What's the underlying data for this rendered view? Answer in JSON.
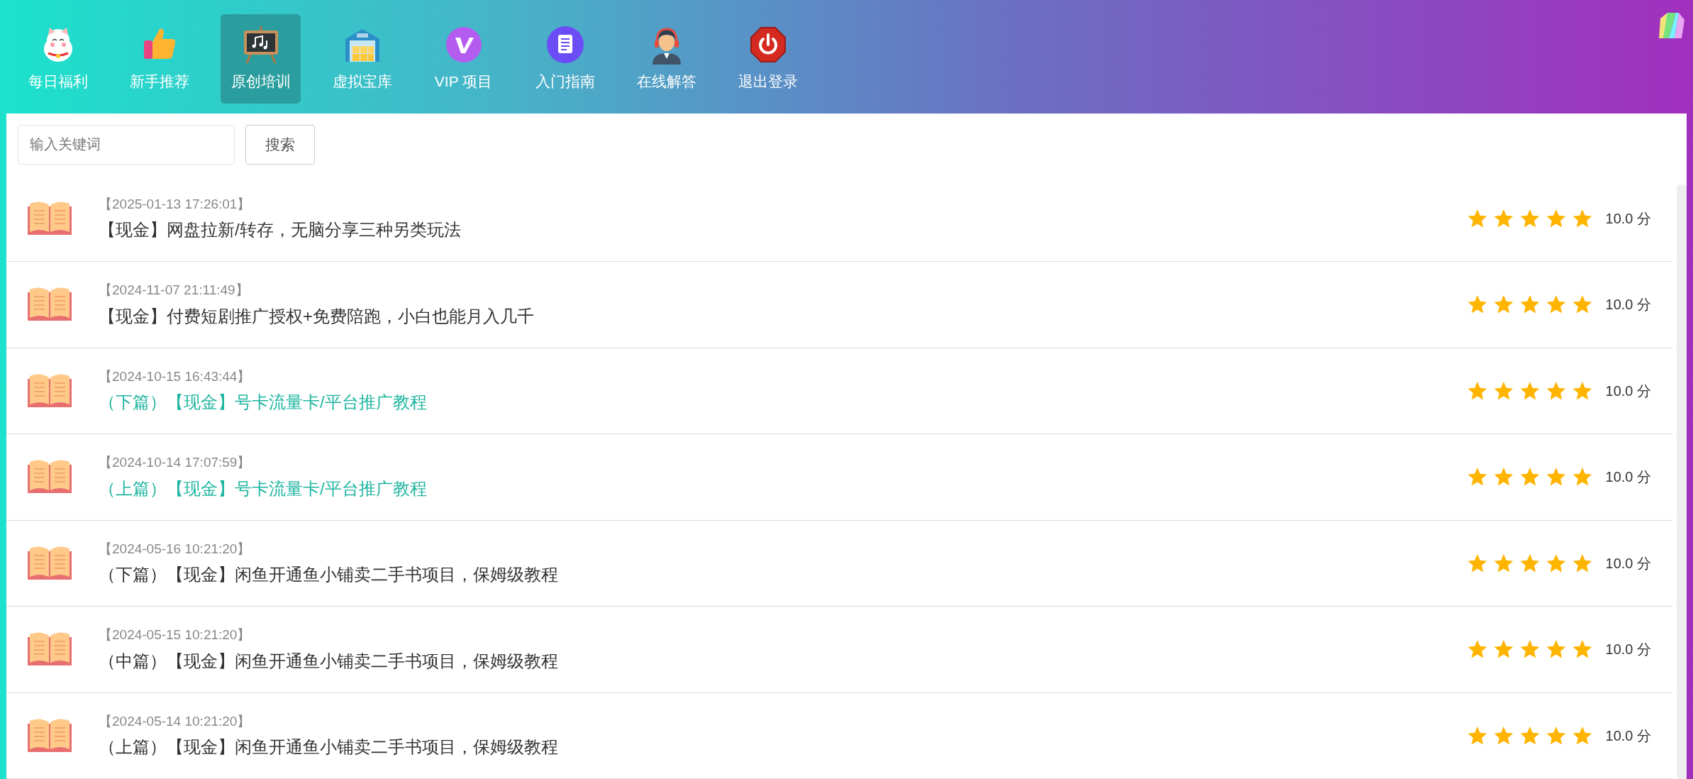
{
  "nav": [
    {
      "label": "每日福利",
      "kind": "cat",
      "selected": false
    },
    {
      "label": "新手推荐",
      "kind": "thumb",
      "selected": false
    },
    {
      "label": "原创培训",
      "kind": "board",
      "selected": true
    },
    {
      "label": "虚拟宝库",
      "kind": "warehouse",
      "selected": false
    },
    {
      "label": "VIP 项目",
      "kind": "vip",
      "selected": false
    },
    {
      "label": "入门指南",
      "kind": "doc",
      "selected": false
    },
    {
      "label": "在线解答",
      "kind": "agent",
      "selected": false
    },
    {
      "label": "退出登录",
      "kind": "power",
      "selected": false
    }
  ],
  "search": {
    "placeholder": "输入关键词",
    "button": "搜索"
  },
  "articles": [
    {
      "date": "【2025-01-13 17:26:01】",
      "title": "【现金】网盘拉新/转存，无脑分享三种另类玩法",
      "visited": false,
      "stars": 5,
      "score": "10.0 分"
    },
    {
      "date": "【2024-11-07 21:11:49】",
      "title": "【现金】付费短剧推广授权+免费陪跑，小白也能月入几千",
      "visited": false,
      "stars": 5,
      "score": "10.0 分"
    },
    {
      "date": "【2024-10-15 16:43:44】",
      "title": "（下篇）【现金】号卡流量卡/平台推广教程",
      "visited": true,
      "stars": 5,
      "score": "10.0 分"
    },
    {
      "date": "【2024-10-14 17:07:59】",
      "title": "（上篇）【现金】号卡流量卡/平台推广教程",
      "visited": true,
      "stars": 5,
      "score": "10.0 分"
    },
    {
      "date": "【2024-05-16 10:21:20】",
      "title": "（下篇）【现金】闲鱼开通鱼小铺卖二手书项目，保姆级教程",
      "visited": false,
      "stars": 5,
      "score": "10.0 分"
    },
    {
      "date": "【2024-05-15 10:21:20】",
      "title": "（中篇）【现金】闲鱼开通鱼小铺卖二手书项目，保姆级教程",
      "visited": false,
      "stars": 5,
      "score": "10.0 分"
    },
    {
      "date": "【2024-05-14 10:21:20】",
      "title": "（上篇）【现金】闲鱼开通鱼小铺卖二手书项目，保姆级教程",
      "visited": false,
      "stars": 5,
      "score": "10.0 分"
    }
  ]
}
